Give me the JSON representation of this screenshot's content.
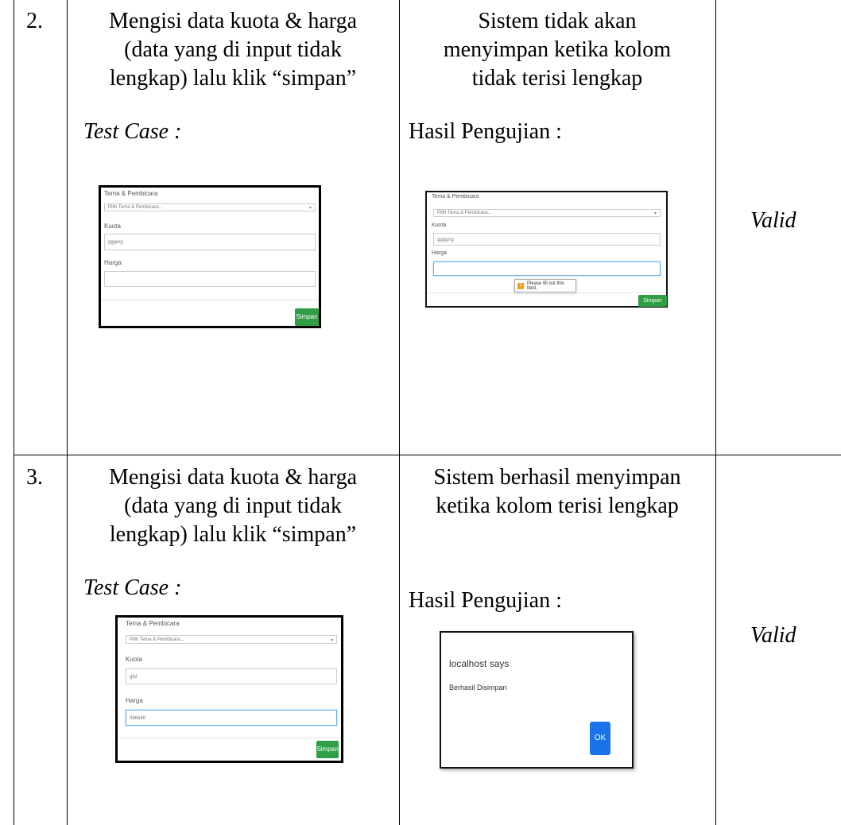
{
  "rows": [
    {
      "number": "2.",
      "action": [
        "Mengisi data kuota & harga",
        "(data yang di input tidak",
        "lengkap) lalu klik “simpan”"
      ],
      "test_case_label": "Test Case :",
      "expected": [
        "Sistem tidak akan",
        "menyimpan ketika kolom",
        "tidak terisi lengkap"
      ],
      "result_label": "Hasil Pengujian :",
      "status": "Valid",
      "test_form": {
        "select_label": "Tema & Pembicara",
        "select_value": "Pilih Tema & Pembicara...",
        "kuota_label": "Kuota",
        "kuota_value": "gggerg",
        "harga_label": "Harga",
        "harga_value": "",
        "save_button": "Simpan"
      },
      "result_form": {
        "select_label": "Tema & Pembicara",
        "select_value": "Pilih Tema & Pembicara...",
        "kuota_label": "Kuota",
        "kuota_value": "ggggrrg",
        "harga_label": "Harga",
        "harga_value": "",
        "tooltip": "Please fill out this field.",
        "save_button": "Simpan"
      }
    },
    {
      "number": "3.",
      "action": [
        "Mengisi data kuota & harga",
        "(data yang di input tidak",
        "lengkap) lalu klik “simpan”"
      ],
      "test_case_label": "Test Case :",
      "expected": [
        "Sistem berhasil menyimpan",
        "ketika kolom terisi lengkap"
      ],
      "result_label": "Hasil Pengujian :",
      "status": "Valid",
      "test_form": {
        "select_label": "Tema & Pembicara",
        "select_value": "Pilih Tema & Pembicara...",
        "kuota_label": "Kuota",
        "kuota_value": "gfsf",
        "harga_label": "Harga",
        "harga_value": "366646",
        "save_button": "Simpan"
      },
      "result_dialog": {
        "title": "localhost says",
        "message": "Berhasil Disimpan",
        "ok_button": "OK"
      }
    }
  ]
}
